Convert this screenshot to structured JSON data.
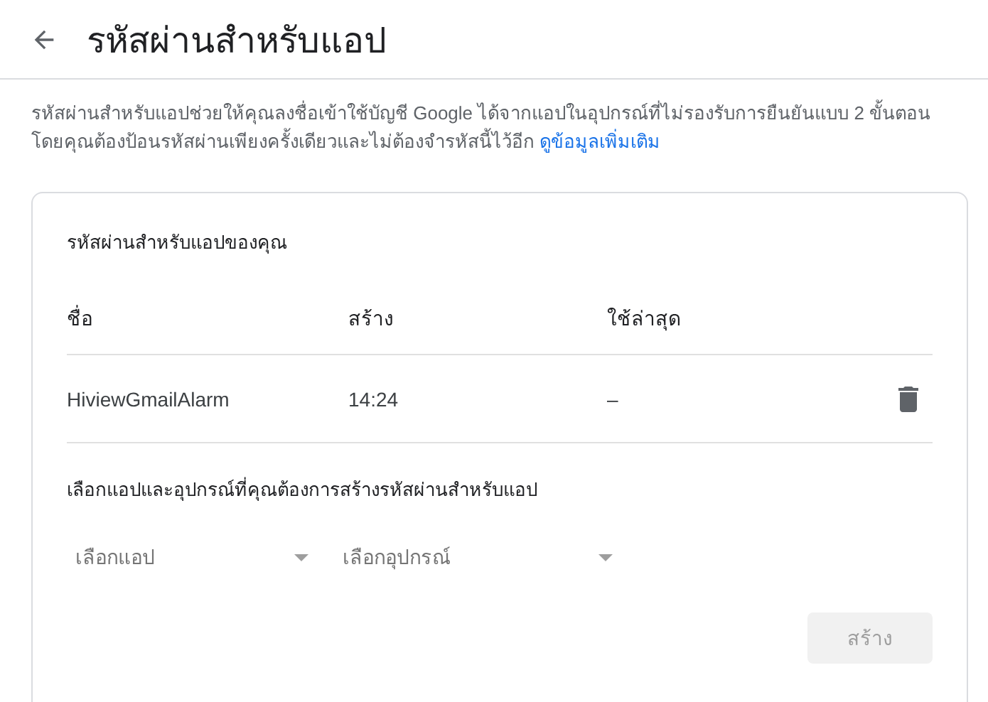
{
  "header": {
    "title": "รหัสผ่านสำหรับแอป"
  },
  "description": {
    "text": "รหัสผ่านสำหรับแอปช่วยให้คุณลงชื่อเข้าใช้บัญชี Google ได้จากแอปในอุปกรณ์ที่ไม่รองรับการยืนยันแบบ 2 ขั้นตอน โดยคุณต้องป้อนรหัสผ่านเพียงครั้งเดียวและไม่ต้องจำรหัสนี้ไว้อีก",
    "link": "ดูข้อมูลเพิ่มเติม"
  },
  "card": {
    "title": "รหัสผ่านสำหรับแอปของคุณ",
    "table": {
      "columns": [
        "ชื่อ",
        "สร้าง",
        "ใช้ล่าสุด"
      ],
      "rows": [
        {
          "name": "HiviewGmailAlarm",
          "created": "14:24",
          "last_used": "–"
        }
      ]
    },
    "prompt": "เลือกแอปและอุปกรณ์ที่คุณต้องการสร้างรหัสผ่านสำหรับแอป",
    "selects": [
      {
        "placeholder": "เลือกแอป"
      },
      {
        "placeholder": "เลือกอุปกรณ์"
      }
    ],
    "button": {
      "label": "สร้าง",
      "disabled": true
    }
  }
}
